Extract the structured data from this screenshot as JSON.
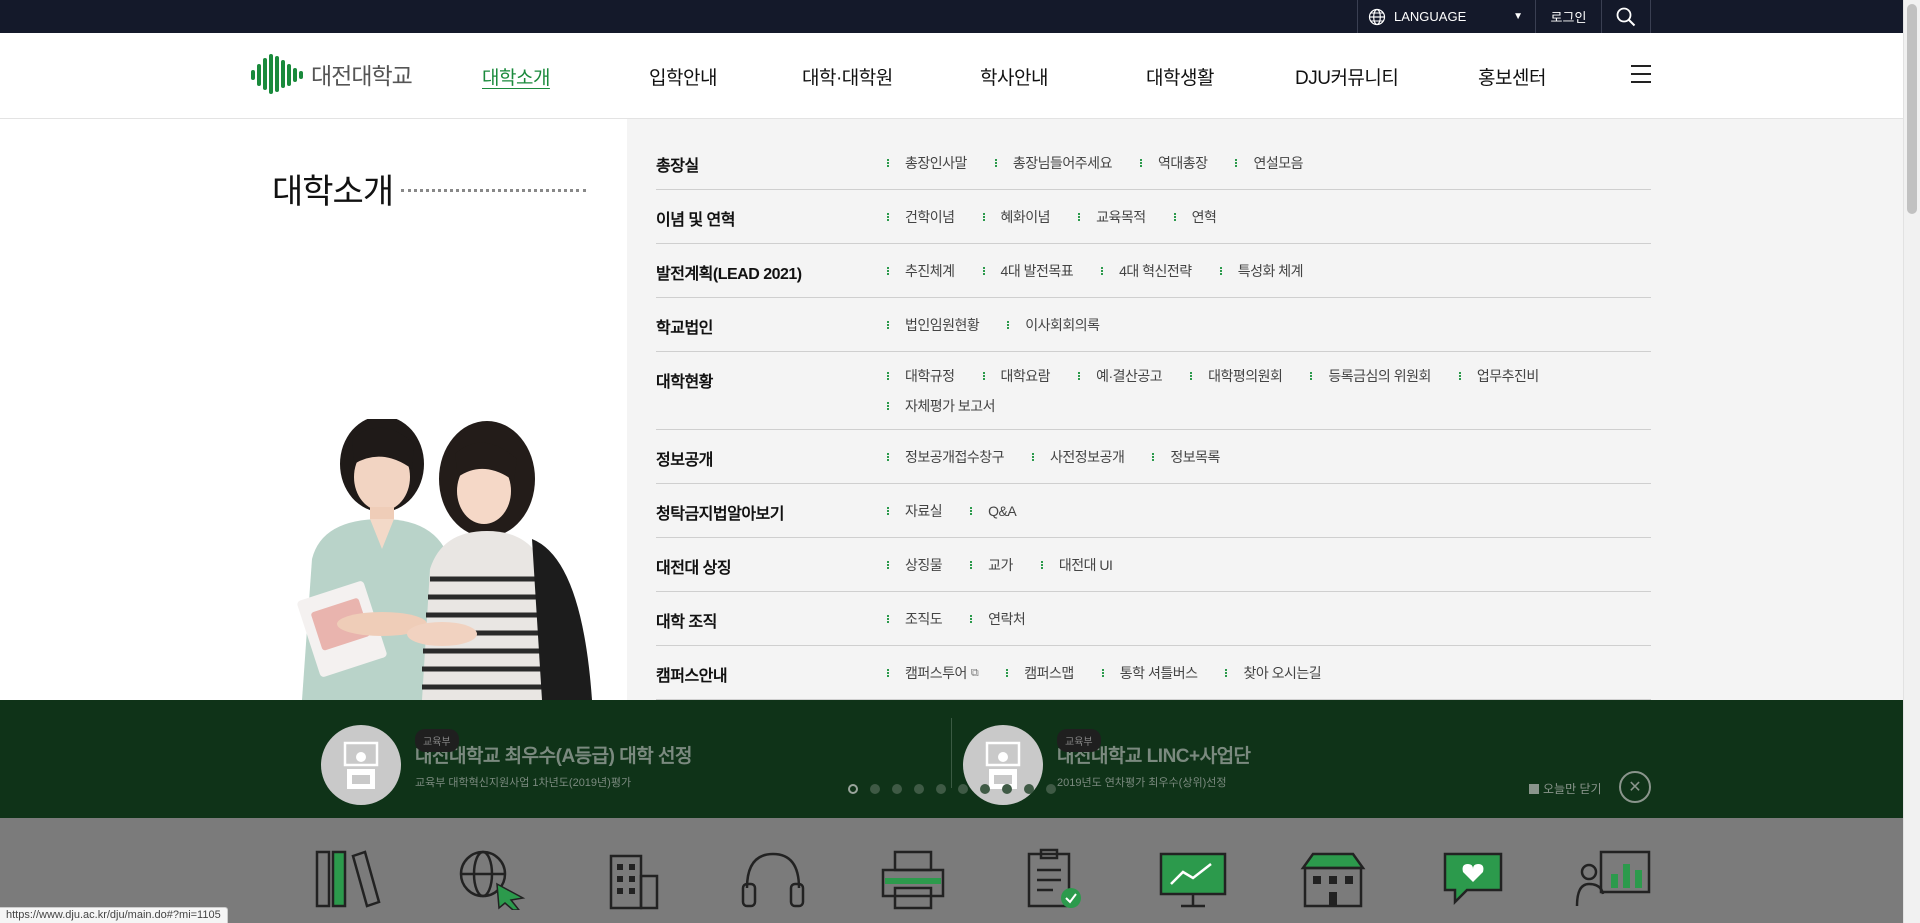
{
  "topbar": {
    "language_label": "LANGUAGE",
    "login_label": "로그인",
    "icons": [
      "globe-icon",
      "search-icon"
    ]
  },
  "header": {
    "logo_text": "대전대학교",
    "nav": [
      {
        "label": "대학소개",
        "active": true
      },
      {
        "label": "입학안내",
        "active": false
      },
      {
        "label": "대학·대학원",
        "active": false
      },
      {
        "label": "학사안내",
        "active": false
      },
      {
        "label": "대학생활",
        "active": false
      },
      {
        "label": "DJU커뮤니티",
        "active": false
      },
      {
        "label": "홍보센터",
        "active": false
      }
    ],
    "accent_color": "#1a8a3c"
  },
  "mega": {
    "title": "대학소개",
    "rows": [
      {
        "title": "총장실",
        "links": [
          "총장인사말",
          "총장님들어주세요",
          "역대총장",
          "연설모음"
        ]
      },
      {
        "title": "이념 및 연혁",
        "links": [
          "건학이념",
          "혜화이념",
          "교육목적",
          "연혁"
        ]
      },
      {
        "title": "발전계획(LEAD 2021)",
        "links": [
          "추진체계",
          "4대 발전목표",
          "4대 혁신전략",
          "특성화 체계"
        ]
      },
      {
        "title": "학교법인",
        "links": [
          "법인임원현황",
          "이사회회의록"
        ]
      },
      {
        "title": "대학현황",
        "links": [
          "대학규정",
          "대학요람",
          "예·결산공고",
          "대학평의원회",
          "등록금심의 위원회",
          "업무추진비",
          "자체평가 보고서"
        ]
      },
      {
        "title": "정보공개",
        "links": [
          "정보공개접수창구",
          "사전정보공개",
          "정보목록"
        ]
      },
      {
        "title": "청탁금지법알아보기",
        "links": [
          "자료실",
          "Q&A"
        ]
      },
      {
        "title": "대전대 상징",
        "links": [
          "상징물",
          "교가",
          "대전대 UI"
        ]
      },
      {
        "title": "대학 조직",
        "links": [
          "조직도",
          "연락처"
        ]
      },
      {
        "title": "캠퍼스안내",
        "links": [
          "캠퍼스투어",
          "캠퍼스맵",
          "통학 셔틀버스",
          "찾아 오시는길"
        ]
      }
    ]
  },
  "banner": {
    "awards": [
      {
        "title": "대전대학교 최우수(A등급) 대학 선정",
        "sub": "교육부 대학혁신지원사업 1차년도(2019년)평가",
        "tag": "교육부"
      },
      {
        "title": "대전대학교 LINC+사업단",
        "sub": "2019년도 연차평가 최우수(상위)선정",
        "tag": "교육부"
      }
    ],
    "pager_count": 10,
    "pager_active": 1,
    "close_today_label": "오늘만 닫기",
    "bg_color": "#0f3318"
  },
  "quick_icons": [
    "library-icon",
    "globe-click-icon",
    "building-icon",
    "headset-icon",
    "printer-icon",
    "clipboard-check-icon",
    "presentation-icon",
    "dormitory-icon",
    "chat-heart-icon",
    "chart-person-icon"
  ],
  "status_url": "https://www.dju.ac.kr/dju/main.do#?mi=1105"
}
